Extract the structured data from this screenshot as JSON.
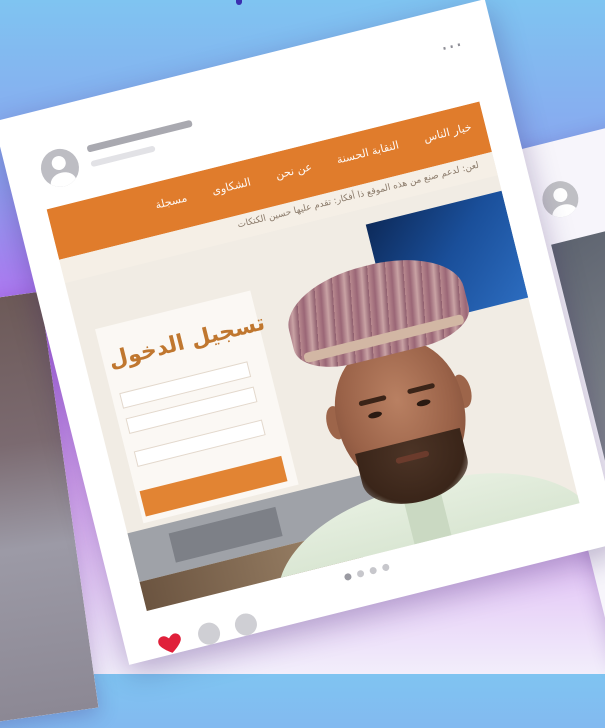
{
  "post": {
    "menu_label": "···",
    "photo": {
      "site_nav": [
        "خيار الناس",
        "النقابة الحسنة",
        "عن نحن",
        "الشكاوى",
        "مسجلة"
      ],
      "site_subbar": "لعن: لدعم صنع من هذه الموقع ذا أفكار: تقدم عليها حسين الكتكات",
      "login_title": "تسجيل الدخول",
      "watermark": ""
    },
    "pager": {
      "count": 4,
      "active_index": 0
    },
    "liked": true
  },
  "colors": {
    "background_top": "#7fc4f1",
    "background_mid": "#b46ef0",
    "card_bg": "#ffffff",
    "site_orange": "#e07c2c",
    "like_red": "#e0203a",
    "action_gray": "#cfcfd4"
  },
  "icons": {
    "avatar": "user-avatar-icon",
    "menu": "more-dots-icon",
    "like": "heart-icon"
  }
}
